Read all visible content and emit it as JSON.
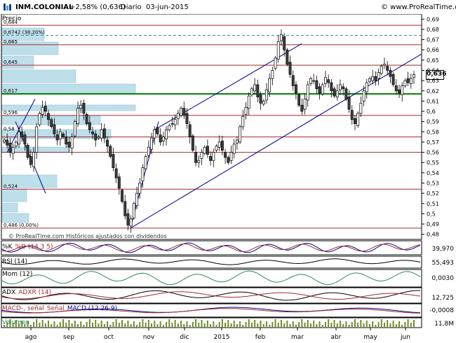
{
  "header": {
    "ticker": "INM.COLONIAL",
    "change": "+2,58% (0,636)",
    "period": "Diario",
    "date": "03-jun-2015",
    "site": "© www.ProRealTime.com",
    "logo_icon": "prorealtime-logo-icon"
  },
  "price_panel": {
    "label": "Precio",
    "watermark": "© ProRealTime.com  Históricos ajustados con dividendos",
    "last_value": "0,636",
    "last_value_color": "#ffff00",
    "fib_labels": [
      {
        "text": "0,684",
        "price": 0.684
      },
      {
        "text": "0,6742 (38,20%)",
        "price": 0.6742
      },
      {
        "text": "0,665",
        "price": 0.665
      },
      {
        "text": "0,645",
        "price": 0.645
      },
      {
        "text": "0,617",
        "price": 0.617
      },
      {
        "text": "0,596",
        "price": 0.596
      },
      {
        "text": "0,58",
        "price": 0.58
      },
      {
        "text": "0,524",
        "price": 0.524
      },
      {
        "text": "0,486 (0,00%)",
        "price": 0.486
      }
    ]
  },
  "indicators": [
    {
      "key": "stoch",
      "labels": [
        "%K",
        "%D (14 3 5)"
      ],
      "value": "39,970"
    },
    {
      "key": "rsi",
      "labels": [
        "RSI (14)"
      ],
      "value": "55,493"
    },
    {
      "key": "mom",
      "labels": [
        "Mom (12)"
      ],
      "value": "0,0030"
    },
    {
      "key": "adx",
      "labels": [
        "ADX",
        "ADXR (14)"
      ],
      "value": "12,725"
    },
    {
      "key": "macd",
      "labels": [
        "MACD-, señal",
        "Señal",
        "MACD (12 26 9)"
      ],
      "value": "-0,0008"
    },
    {
      "key": "vol",
      "labels": [
        "Volumen"
      ],
      "value": "11,8M"
    }
  ],
  "colors": {
    "up": "#ffffff",
    "down": "#404040",
    "horizontal_line": "#a52a2a",
    "support_line": "#008000",
    "trend_line": "#00008b",
    "volume_profile": "#add8e6",
    "fib_dashed": "#4682b4",
    "panel_border": "#000000"
  },
  "chart_data": {
    "type": "candlestick",
    "title": "INM.COLONIAL",
    "ylim": [
      0.475,
      0.695
    ],
    "y_ticks": [
      "0,69",
      "0,68",
      "0,67",
      "0,66",
      "0,65",
      "0,64",
      "0,63",
      "0,62",
      "0,61",
      "0,6",
      "0,59",
      "0,58",
      "0,57",
      "0,56",
      "0,55",
      "0,54",
      "0,53",
      "0,52",
      "0,51",
      "0,5",
      "0,49",
      "0,48"
    ],
    "x_labels": [
      "ago",
      "sep",
      "oct",
      "nov",
      "dic",
      "2015",
      "feb",
      "mar",
      "abr",
      "may",
      "jun"
    ],
    "horizontal_levels": [
      0.684,
      0.665,
      0.645,
      0.617,
      0.596,
      0.575,
      0.56,
      0.524,
      0.486
    ],
    "support_levels": [
      0.617
    ],
    "close_series": [
      0.572,
      0.567,
      0.56,
      0.565,
      0.57,
      0.58,
      0.575,
      0.568,
      0.555,
      0.548,
      0.56,
      0.585,
      0.598,
      0.604,
      0.6,
      0.592,
      0.585,
      0.578,
      0.572,
      0.58,
      0.575,
      0.568,
      0.565,
      0.575,
      0.59,
      0.603,
      0.606,
      0.598,
      0.588,
      0.582,
      0.578,
      0.572,
      0.575,
      0.582,
      0.574,
      0.566,
      0.556,
      0.545,
      0.535,
      0.525,
      0.512,
      0.498,
      0.489,
      0.495,
      0.51,
      0.52,
      0.53,
      0.545,
      0.556,
      0.565,
      0.574,
      0.582,
      0.578,
      0.57,
      0.575,
      0.582,
      0.586,
      0.588,
      0.592,
      0.598,
      0.603,
      0.596,
      0.588,
      0.575,
      0.562,
      0.55,
      0.552,
      0.56,
      0.565,
      0.558,
      0.552,
      0.56,
      0.566,
      0.57,
      0.562,
      0.555,
      0.55,
      0.56,
      0.568,
      0.572,
      0.585,
      0.595,
      0.604,
      0.615,
      0.622,
      0.626,
      0.614,
      0.608,
      0.61,
      0.621,
      0.632,
      0.64,
      0.652,
      0.668,
      0.675,
      0.66,
      0.646,
      0.636,
      0.625,
      0.618,
      0.606,
      0.6,
      0.612,
      0.626,
      0.632,
      0.63,
      0.622,
      0.618,
      0.626,
      0.633,
      0.628,
      0.62,
      0.615,
      0.62,
      0.626,
      0.622,
      0.612,
      0.602,
      0.592,
      0.588,
      0.598,
      0.608,
      0.62,
      0.628,
      0.632,
      0.634,
      0.63,
      0.638,
      0.644,
      0.646,
      0.64,
      0.634,
      0.626,
      0.62,
      0.618,
      0.625,
      0.63,
      0.628,
      0.632,
      0.636
    ],
    "indicator_values": {
      "stoch_k": 39.97,
      "rsi": 55.493,
      "momentum": 0.003,
      "adx": 12.725,
      "macd": -0.0008,
      "volume": "11,8M"
    }
  }
}
